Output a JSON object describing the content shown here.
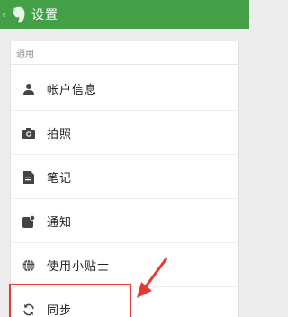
{
  "header": {
    "back_glyph": "‹",
    "logo_icon": "evernote-elephant-icon",
    "title": "设置"
  },
  "section": {
    "title": "通用"
  },
  "items": [
    {
      "label": "帐户信息",
      "icon": "person-icon"
    },
    {
      "label": "拍照",
      "icon": "camera-icon"
    },
    {
      "label": "笔记",
      "icon": "note-icon"
    },
    {
      "label": "通知",
      "icon": "notification-icon"
    },
    {
      "label": "使用小贴士",
      "icon": "globe-icon"
    },
    {
      "label": "同步",
      "icon": "sync-icon"
    }
  ],
  "colors": {
    "appbar": "#43a047",
    "highlight": "#e53935"
  }
}
